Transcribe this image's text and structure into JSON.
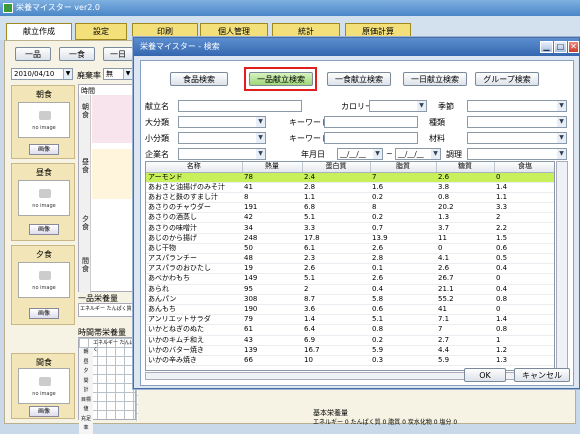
{
  "app": {
    "title": "栄養マイスター ver2.0"
  },
  "main_tabs": [
    {
      "label": "献立作成"
    },
    {
      "label": "設定"
    },
    {
      "label": "印刷"
    },
    {
      "label": "個人管理"
    },
    {
      "label": "統計"
    },
    {
      "label": "原価計算"
    }
  ],
  "toolbar": {
    "ippin": "一品",
    "isshoku": "一食",
    "ichinichi": "一日"
  },
  "date": {
    "value": "2010/04/10",
    "haikikei_label": "廃棄率",
    "haikikei_value": "無"
  },
  "grid_header": "時間",
  "meals": [
    {
      "label": "朝食",
      "button": "画像",
      "side": "朝\n食"
    },
    {
      "label": "昼食",
      "button": "画像",
      "side": "昼\n食"
    },
    {
      "label": "夕食",
      "button": "画像",
      "side": "夕\n食"
    },
    {
      "label": "間食",
      "button": "画像",
      "side": "間\n食"
    }
  ],
  "no_image": "no image",
  "bottom": {
    "ippin_label": "一品栄養量",
    "ippin_cols": "エネルギー たんぱく質",
    "jikan_label": "時間帯栄養量",
    "jikan_cols": "エネルギー たんぱく",
    "rows": [
      "朝",
      "昼",
      "夕",
      "間",
      "計",
      "目標値",
      "充足率"
    ],
    "kihon_label": "基本栄養量",
    "kihon_line": "エネルギー  0  たんぱく質   0  脂質   0  炭水化物   0  塩分   0"
  },
  "dialog": {
    "title": "栄養マイスター - 検索",
    "tabs": [
      "食品検索",
      "一品献立検索",
      "一食献立検索",
      "一日献立検索",
      "グループ検索"
    ],
    "labels": {
      "kondate_name": "献立名",
      "calorie": "カロリー",
      "kisetsu": "季節",
      "daibunrui": "大分類",
      "keyword1": "キーワード",
      "shurui": "種類",
      "shobunrui": "小分類",
      "keyword2": "キーワード",
      "zairyo": "材料",
      "kigyo": "企業名",
      "nengappi": "年月日",
      "chouri": "調理",
      "tilde": "~",
      "date_from": "__/__/__",
      "date_to": "__/__/__"
    },
    "columns": [
      "名称",
      "熱量",
      "蛋白質",
      "脂質",
      "糖質",
      "食塩"
    ],
    "rows": [
      [
        "アーモンド",
        "78",
        "2.4",
        "7",
        "2.6",
        "0"
      ],
      [
        "あおさと油揚げのみそ汁",
        "41",
        "2.8",
        "1.6",
        "3.8",
        "1.4"
      ],
      [
        "あおさと麩のすまし汁",
        "8",
        "1.1",
        "0.2",
        "0.8",
        "1.1"
      ],
      [
        "あさりのチャウダー",
        "191",
        "6.8",
        "8",
        "20.2",
        "3.3"
      ],
      [
        "あさりの酒蒸し",
        "42",
        "5.1",
        "0.2",
        "1.3",
        "2"
      ],
      [
        "あさりの味噌汁",
        "34",
        "3.3",
        "0.7",
        "3.7",
        "2.2"
      ],
      [
        "あじのから揚げ",
        "248",
        "17.8",
        "13.9",
        "11",
        "1.5"
      ],
      [
        "あじ干物",
        "50",
        "6.1",
        "2.6",
        "0",
        "0.6"
      ],
      [
        "アスパランチー",
        "48",
        "2.3",
        "2.8",
        "4.1",
        "0.5"
      ],
      [
        "アスパラのおひたし",
        "19",
        "2.6",
        "0.1",
        "2.6",
        "0.4"
      ],
      [
        "あべかわもち",
        "149",
        "5.1",
        "2.6",
        "26.7",
        "0"
      ],
      [
        "あられ",
        "95",
        "2",
        "0.4",
        "21.1",
        "0.4"
      ],
      [
        "あんパン",
        "308",
        "8.7",
        "5.8",
        "55.2",
        "0.8"
      ],
      [
        "あんもち",
        "190",
        "3.6",
        "0.6",
        "41",
        "0"
      ],
      [
        "アンリエットサラダ",
        "79",
        "1.4",
        "5.1",
        "7.1",
        "1.4"
      ],
      [
        "いかとねぎのぬた",
        "61",
        "6.4",
        "0.8",
        "7",
        "0.8"
      ],
      [
        "いかのキムチ和え",
        "43",
        "6.9",
        "0.2",
        "2.7",
        "1"
      ],
      [
        "いかのバター焼き",
        "139",
        "16.7",
        "5.9",
        "4.4",
        "1.2"
      ],
      [
        "いかの辛み焼き",
        "66",
        "10",
        "0.3",
        "5.9",
        "1.3"
      ]
    ],
    "ok": "OK",
    "cancel": "キャンセル"
  }
}
